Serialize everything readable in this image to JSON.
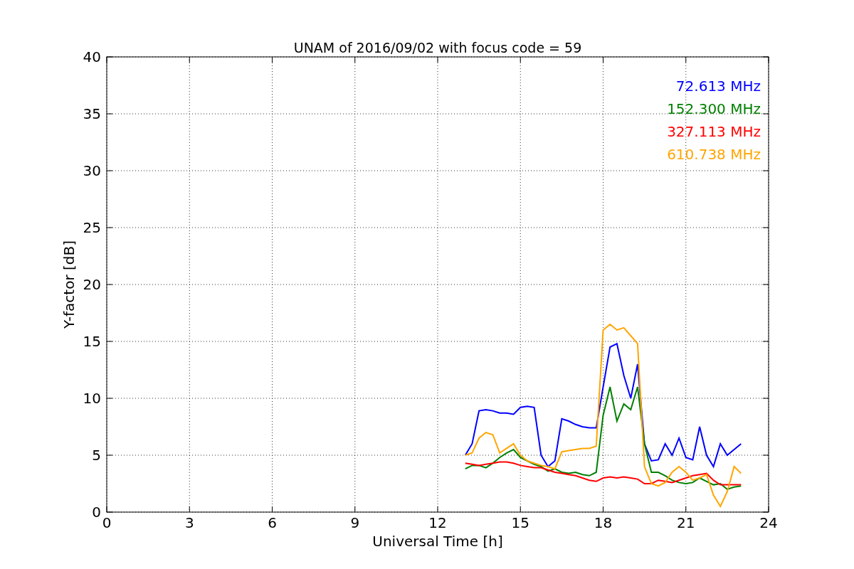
{
  "chart_data": {
    "type": "line",
    "title": "UNAM of 2016/09/02 with focus code = 59",
    "xlabel": "Universal Time [h]",
    "ylabel": "Y-factor [dB]",
    "x": [
      13,
      13.25,
      13.5,
      13.75,
      14,
      14.25,
      14.5,
      14.75,
      15,
      15.25,
      15.5,
      15.75,
      16,
      16.25,
      16.5,
      16.75,
      17,
      17.25,
      17.5,
      17.75,
      18,
      18.25,
      18.5,
      18.75,
      19,
      19.25,
      19.5,
      19.75,
      20,
      20.25,
      20.5,
      20.75,
      21,
      21.25,
      21.5,
      21.75,
      22,
      22.25,
      22.5,
      22.75,
      23
    ],
    "series": [
      {
        "name": "72.613 MHz",
        "color": "#0000ff",
        "values": [
          5,
          6,
          8.9,
          9,
          8.9,
          8.7,
          8.7,
          8.6,
          9.2,
          9.3,
          9.2,
          5,
          4,
          4.5,
          8.2,
          8,
          7.7,
          7.5,
          7.4,
          7.4,
          11,
          14.5,
          14.8,
          12,
          10,
          13,
          6,
          4.5,
          4.6,
          6,
          5,
          6.5,
          4.8,
          4.6,
          7.5,
          5,
          4,
          6,
          5,
          5.5,
          6
        ]
      },
      {
        "name": "152.300 MHz",
        "color": "#008000",
        "values": [
          3.8,
          4.1,
          4.1,
          3.9,
          4.3,
          4.8,
          5.2,
          5.5,
          4.8,
          4.5,
          4.2,
          4,
          3.6,
          3.8,
          3.5,
          3.4,
          3.5,
          3.3,
          3.2,
          3.5,
          8.5,
          11,
          8,
          9.5,
          9,
          11,
          6,
          3.5,
          3.5,
          3.2,
          2.8,
          2.6,
          2.5,
          2.6,
          3,
          2.7,
          2.4,
          2.5,
          2,
          2.2,
          2.3
        ]
      },
      {
        "name": "327.113 MHz",
        "color": "#ff0000",
        "values": [
          4.3,
          4.2,
          4.1,
          4.2,
          4.3,
          4.4,
          4.4,
          4.3,
          4.1,
          4,
          3.9,
          3.9,
          3.7,
          3.5,
          3.4,
          3.3,
          3.2,
          3,
          2.8,
          2.7,
          3,
          3.1,
          3,
          3.1,
          3,
          2.9,
          2.5,
          2.5,
          2.8,
          2.7,
          2.6,
          2.8,
          3,
          3.2,
          3.3,
          3.4,
          2.8,
          2.4,
          2.4,
          2.4,
          2.4
        ]
      },
      {
        "name": "610.738 MHz",
        "color": "#ffa500",
        "values": [
          5,
          5.2,
          6.5,
          7,
          6.8,
          5.2,
          5.6,
          6,
          5,
          4.5,
          4.3,
          4.1,
          4,
          3.8,
          5.3,
          5.4,
          5.5,
          5.6,
          5.6,
          5.8,
          16,
          16.5,
          16,
          16.2,
          15.5,
          14.8,
          4,
          2.5,
          2.3,
          2.6,
          3.5,
          4,
          3.5,
          2.8,
          3,
          3.3,
          1.5,
          0.5,
          1.8,
          4,
          3.4
        ]
      }
    ],
    "grid": true,
    "xlim": [
      0,
      24
    ],
    "ylim": [
      0,
      40
    ],
    "xticks": [
      0,
      3,
      6,
      9,
      12,
      15,
      18,
      21,
      24
    ],
    "yticks": [
      0,
      5,
      10,
      15,
      20,
      25,
      30,
      35,
      40
    ]
  }
}
